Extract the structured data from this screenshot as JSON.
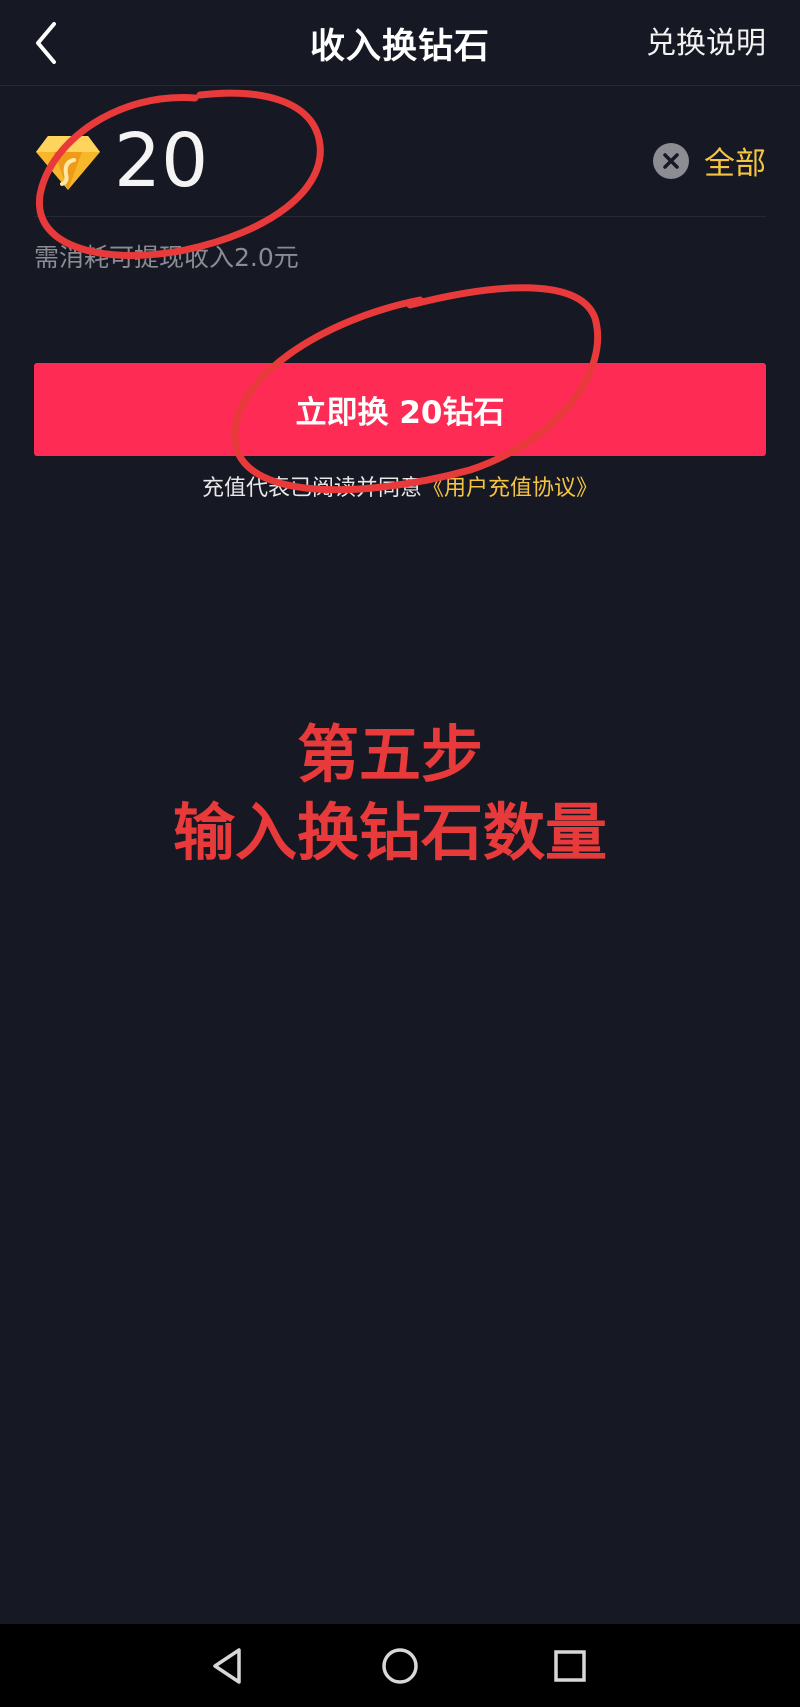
{
  "header": {
    "title": "收入换钻石",
    "help_label": "兑换说明"
  },
  "amount": {
    "value": "20",
    "all_label": "全部",
    "cost_note": "需消耗可提现收入2.0元"
  },
  "cta": {
    "button_label": "立即换 20钻石"
  },
  "agreement": {
    "text": "充值代表已阅读并同意",
    "link": "《用户充值协议》"
  },
  "annotation": {
    "line1": "第五步",
    "line2": "输入换钻石数量",
    "color": "#e83a3a"
  },
  "colors": {
    "background": "#161823",
    "accent": "#fe2c55",
    "gold": "#f5c443"
  },
  "icons": {
    "back": "chevron-left",
    "diamond": "diamond",
    "clear": "clear-x",
    "nav_back": "triangle-back",
    "nav_home": "circle-home",
    "nav_recent": "square-recent"
  }
}
